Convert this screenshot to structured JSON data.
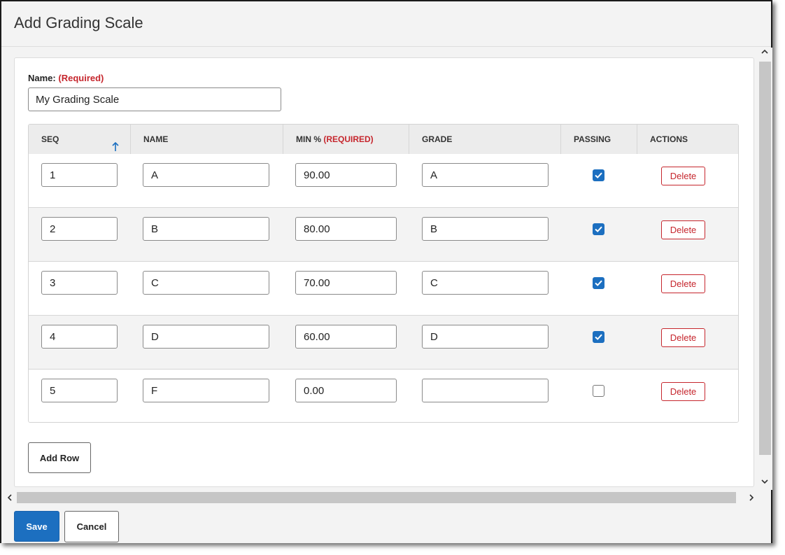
{
  "window": {
    "title": "Add Grading Scale"
  },
  "form": {
    "name_label": "Name:",
    "name_required": "(Required)",
    "name_value": "My Grading Scale"
  },
  "table": {
    "headers": {
      "seq": "SEQ",
      "name": "NAME",
      "min": "MIN %",
      "min_required": "(REQUIRED)",
      "grade": "GRADE",
      "passing": "PASSING",
      "actions": "ACTIONS"
    },
    "sort": {
      "column": "seq",
      "direction": "ascending",
      "icon": "arrow-up-icon"
    },
    "rows": [
      {
        "seq": "1",
        "name": "A",
        "min": "90.00",
        "grade": "A",
        "passing": true,
        "delete_label": "Delete"
      },
      {
        "seq": "2",
        "name": "B",
        "min": "80.00",
        "grade": "B",
        "passing": true,
        "delete_label": "Delete"
      },
      {
        "seq": "3",
        "name": "C",
        "min": "70.00",
        "grade": "C",
        "passing": true,
        "delete_label": "Delete"
      },
      {
        "seq": "4",
        "name": "D",
        "min": "60.00",
        "grade": "D",
        "passing": true,
        "delete_label": "Delete"
      },
      {
        "seq": "5",
        "name": "F",
        "min": "0.00",
        "grade": "",
        "passing": false,
        "delete_label": "Delete"
      }
    ]
  },
  "buttons": {
    "add_row": "Add Row",
    "save": "Save",
    "cancel": "Cancel"
  },
  "colors": {
    "accent": "#1c6fc0",
    "required": "#c6262d",
    "header_bg": "#ececec",
    "page_bg": "#f3f3f3"
  }
}
